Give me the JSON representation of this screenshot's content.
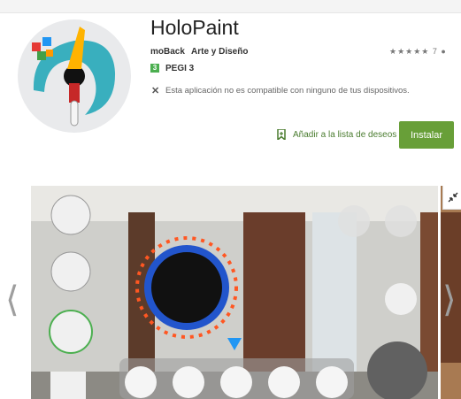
{
  "app": {
    "title": "HoloPaint",
    "developer": "moBack",
    "category": "Arte y Diseño",
    "rating_stars": "★★★★★",
    "rating_count": "7",
    "pegi": "PEGI 3",
    "compat_notice": "Esta aplicación no es compatible con ninguno de tus dispositivos.",
    "wishlist_label": "Añadir a la lista de deseos",
    "install_label": "Instalar"
  },
  "colors": {
    "install_bg": "#689f38",
    "link_green": "#4a7c2f",
    "pegi_green": "#4caf50"
  },
  "icons": [
    "app-logo-icon",
    "pegi-icon",
    "close-x-icon",
    "bookmark-icon",
    "person-icon",
    "arrow-left-icon",
    "arrow-right-icon",
    "expand-icon"
  ]
}
